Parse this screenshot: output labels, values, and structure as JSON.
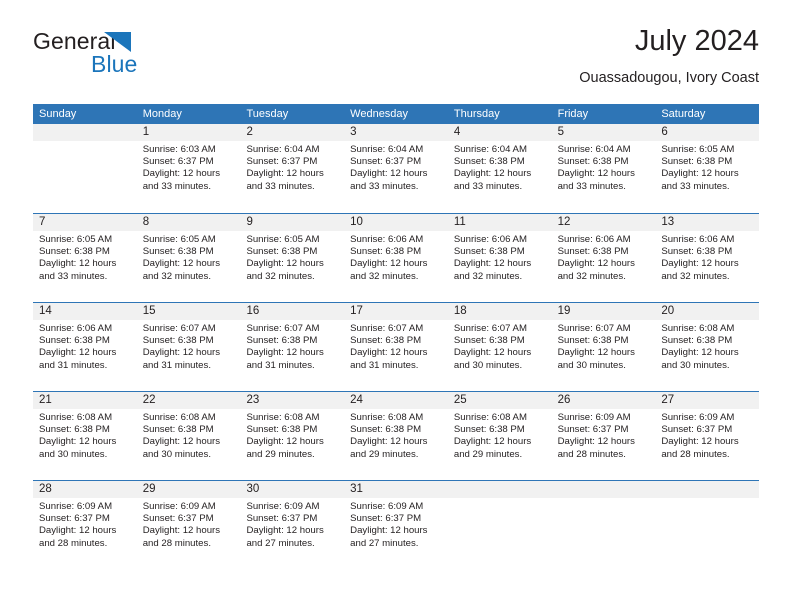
{
  "brand": {
    "word_one": "General",
    "word_two": "Blue",
    "triangle_icon": "triangle-icon"
  },
  "header": {
    "title": "July 2024",
    "subtitle": "Ouassadougou, Ivory Coast"
  },
  "colors": {
    "header_blue": "#2E75B6",
    "brand_blue": "#1B75BB",
    "day_band_gray": "#F1F1F1",
    "text": "#231F20"
  },
  "weekdays": [
    "Sunday",
    "Monday",
    "Tuesday",
    "Wednesday",
    "Thursday",
    "Friday",
    "Saturday"
  ],
  "weeks": [
    [
      {
        "day": "",
        "lines": []
      },
      {
        "day": "1",
        "lines": [
          "Sunrise: 6:03 AM",
          "Sunset: 6:37 PM",
          "Daylight: 12 hours",
          "and 33 minutes."
        ]
      },
      {
        "day": "2",
        "lines": [
          "Sunrise: 6:04 AM",
          "Sunset: 6:37 PM",
          "Daylight: 12 hours",
          "and 33 minutes."
        ]
      },
      {
        "day": "3",
        "lines": [
          "Sunrise: 6:04 AM",
          "Sunset: 6:37 PM",
          "Daylight: 12 hours",
          "and 33 minutes."
        ]
      },
      {
        "day": "4",
        "lines": [
          "Sunrise: 6:04 AM",
          "Sunset: 6:38 PM",
          "Daylight: 12 hours",
          "and 33 minutes."
        ]
      },
      {
        "day": "5",
        "lines": [
          "Sunrise: 6:04 AM",
          "Sunset: 6:38 PM",
          "Daylight: 12 hours",
          "and 33 minutes."
        ]
      },
      {
        "day": "6",
        "lines": [
          "Sunrise: 6:05 AM",
          "Sunset: 6:38 PM",
          "Daylight: 12 hours",
          "and 33 minutes."
        ]
      }
    ],
    [
      {
        "day": "7",
        "lines": [
          "Sunrise: 6:05 AM",
          "Sunset: 6:38 PM",
          "Daylight: 12 hours",
          "and 33 minutes."
        ]
      },
      {
        "day": "8",
        "lines": [
          "Sunrise: 6:05 AM",
          "Sunset: 6:38 PM",
          "Daylight: 12 hours",
          "and 32 minutes."
        ]
      },
      {
        "day": "9",
        "lines": [
          "Sunrise: 6:05 AM",
          "Sunset: 6:38 PM",
          "Daylight: 12 hours",
          "and 32 minutes."
        ]
      },
      {
        "day": "10",
        "lines": [
          "Sunrise: 6:06 AM",
          "Sunset: 6:38 PM",
          "Daylight: 12 hours",
          "and 32 minutes."
        ]
      },
      {
        "day": "11",
        "lines": [
          "Sunrise: 6:06 AM",
          "Sunset: 6:38 PM",
          "Daylight: 12 hours",
          "and 32 minutes."
        ]
      },
      {
        "day": "12",
        "lines": [
          "Sunrise: 6:06 AM",
          "Sunset: 6:38 PM",
          "Daylight: 12 hours",
          "and 32 minutes."
        ]
      },
      {
        "day": "13",
        "lines": [
          "Sunrise: 6:06 AM",
          "Sunset: 6:38 PM",
          "Daylight: 12 hours",
          "and 32 minutes."
        ]
      }
    ],
    [
      {
        "day": "14",
        "lines": [
          "Sunrise: 6:06 AM",
          "Sunset: 6:38 PM",
          "Daylight: 12 hours",
          "and 31 minutes."
        ]
      },
      {
        "day": "15",
        "lines": [
          "Sunrise: 6:07 AM",
          "Sunset: 6:38 PM",
          "Daylight: 12 hours",
          "and 31 minutes."
        ]
      },
      {
        "day": "16",
        "lines": [
          "Sunrise: 6:07 AM",
          "Sunset: 6:38 PM",
          "Daylight: 12 hours",
          "and 31 minutes."
        ]
      },
      {
        "day": "17",
        "lines": [
          "Sunrise: 6:07 AM",
          "Sunset: 6:38 PM",
          "Daylight: 12 hours",
          "and 31 minutes."
        ]
      },
      {
        "day": "18",
        "lines": [
          "Sunrise: 6:07 AM",
          "Sunset: 6:38 PM",
          "Daylight: 12 hours",
          "and 30 minutes."
        ]
      },
      {
        "day": "19",
        "lines": [
          "Sunrise: 6:07 AM",
          "Sunset: 6:38 PM",
          "Daylight: 12 hours",
          "and 30 minutes."
        ]
      },
      {
        "day": "20",
        "lines": [
          "Sunrise: 6:08 AM",
          "Sunset: 6:38 PM",
          "Daylight: 12 hours",
          "and 30 minutes."
        ]
      }
    ],
    [
      {
        "day": "21",
        "lines": [
          "Sunrise: 6:08 AM",
          "Sunset: 6:38 PM",
          "Daylight: 12 hours",
          "and 30 minutes."
        ]
      },
      {
        "day": "22",
        "lines": [
          "Sunrise: 6:08 AM",
          "Sunset: 6:38 PM",
          "Daylight: 12 hours",
          "and 30 minutes."
        ]
      },
      {
        "day": "23",
        "lines": [
          "Sunrise: 6:08 AM",
          "Sunset: 6:38 PM",
          "Daylight: 12 hours",
          "and 29 minutes."
        ]
      },
      {
        "day": "24",
        "lines": [
          "Sunrise: 6:08 AM",
          "Sunset: 6:38 PM",
          "Daylight: 12 hours",
          "and 29 minutes."
        ]
      },
      {
        "day": "25",
        "lines": [
          "Sunrise: 6:08 AM",
          "Sunset: 6:38 PM",
          "Daylight: 12 hours",
          "and 29 minutes."
        ]
      },
      {
        "day": "26",
        "lines": [
          "Sunrise: 6:09 AM",
          "Sunset: 6:37 PM",
          "Daylight: 12 hours",
          "and 28 minutes."
        ]
      },
      {
        "day": "27",
        "lines": [
          "Sunrise: 6:09 AM",
          "Sunset: 6:37 PM",
          "Daylight: 12 hours",
          "and 28 minutes."
        ]
      }
    ],
    [
      {
        "day": "28",
        "lines": [
          "Sunrise: 6:09 AM",
          "Sunset: 6:37 PM",
          "Daylight: 12 hours",
          "and 28 minutes."
        ]
      },
      {
        "day": "29",
        "lines": [
          "Sunrise: 6:09 AM",
          "Sunset: 6:37 PM",
          "Daylight: 12 hours",
          "and 28 minutes."
        ]
      },
      {
        "day": "30",
        "lines": [
          "Sunrise: 6:09 AM",
          "Sunset: 6:37 PM",
          "Daylight: 12 hours",
          "and 27 minutes."
        ]
      },
      {
        "day": "31",
        "lines": [
          "Sunrise: 6:09 AM",
          "Sunset: 6:37 PM",
          "Daylight: 12 hours",
          "and 27 minutes."
        ]
      },
      {
        "day": "",
        "lines": []
      },
      {
        "day": "",
        "lines": []
      },
      {
        "day": "",
        "lines": []
      }
    ]
  ]
}
